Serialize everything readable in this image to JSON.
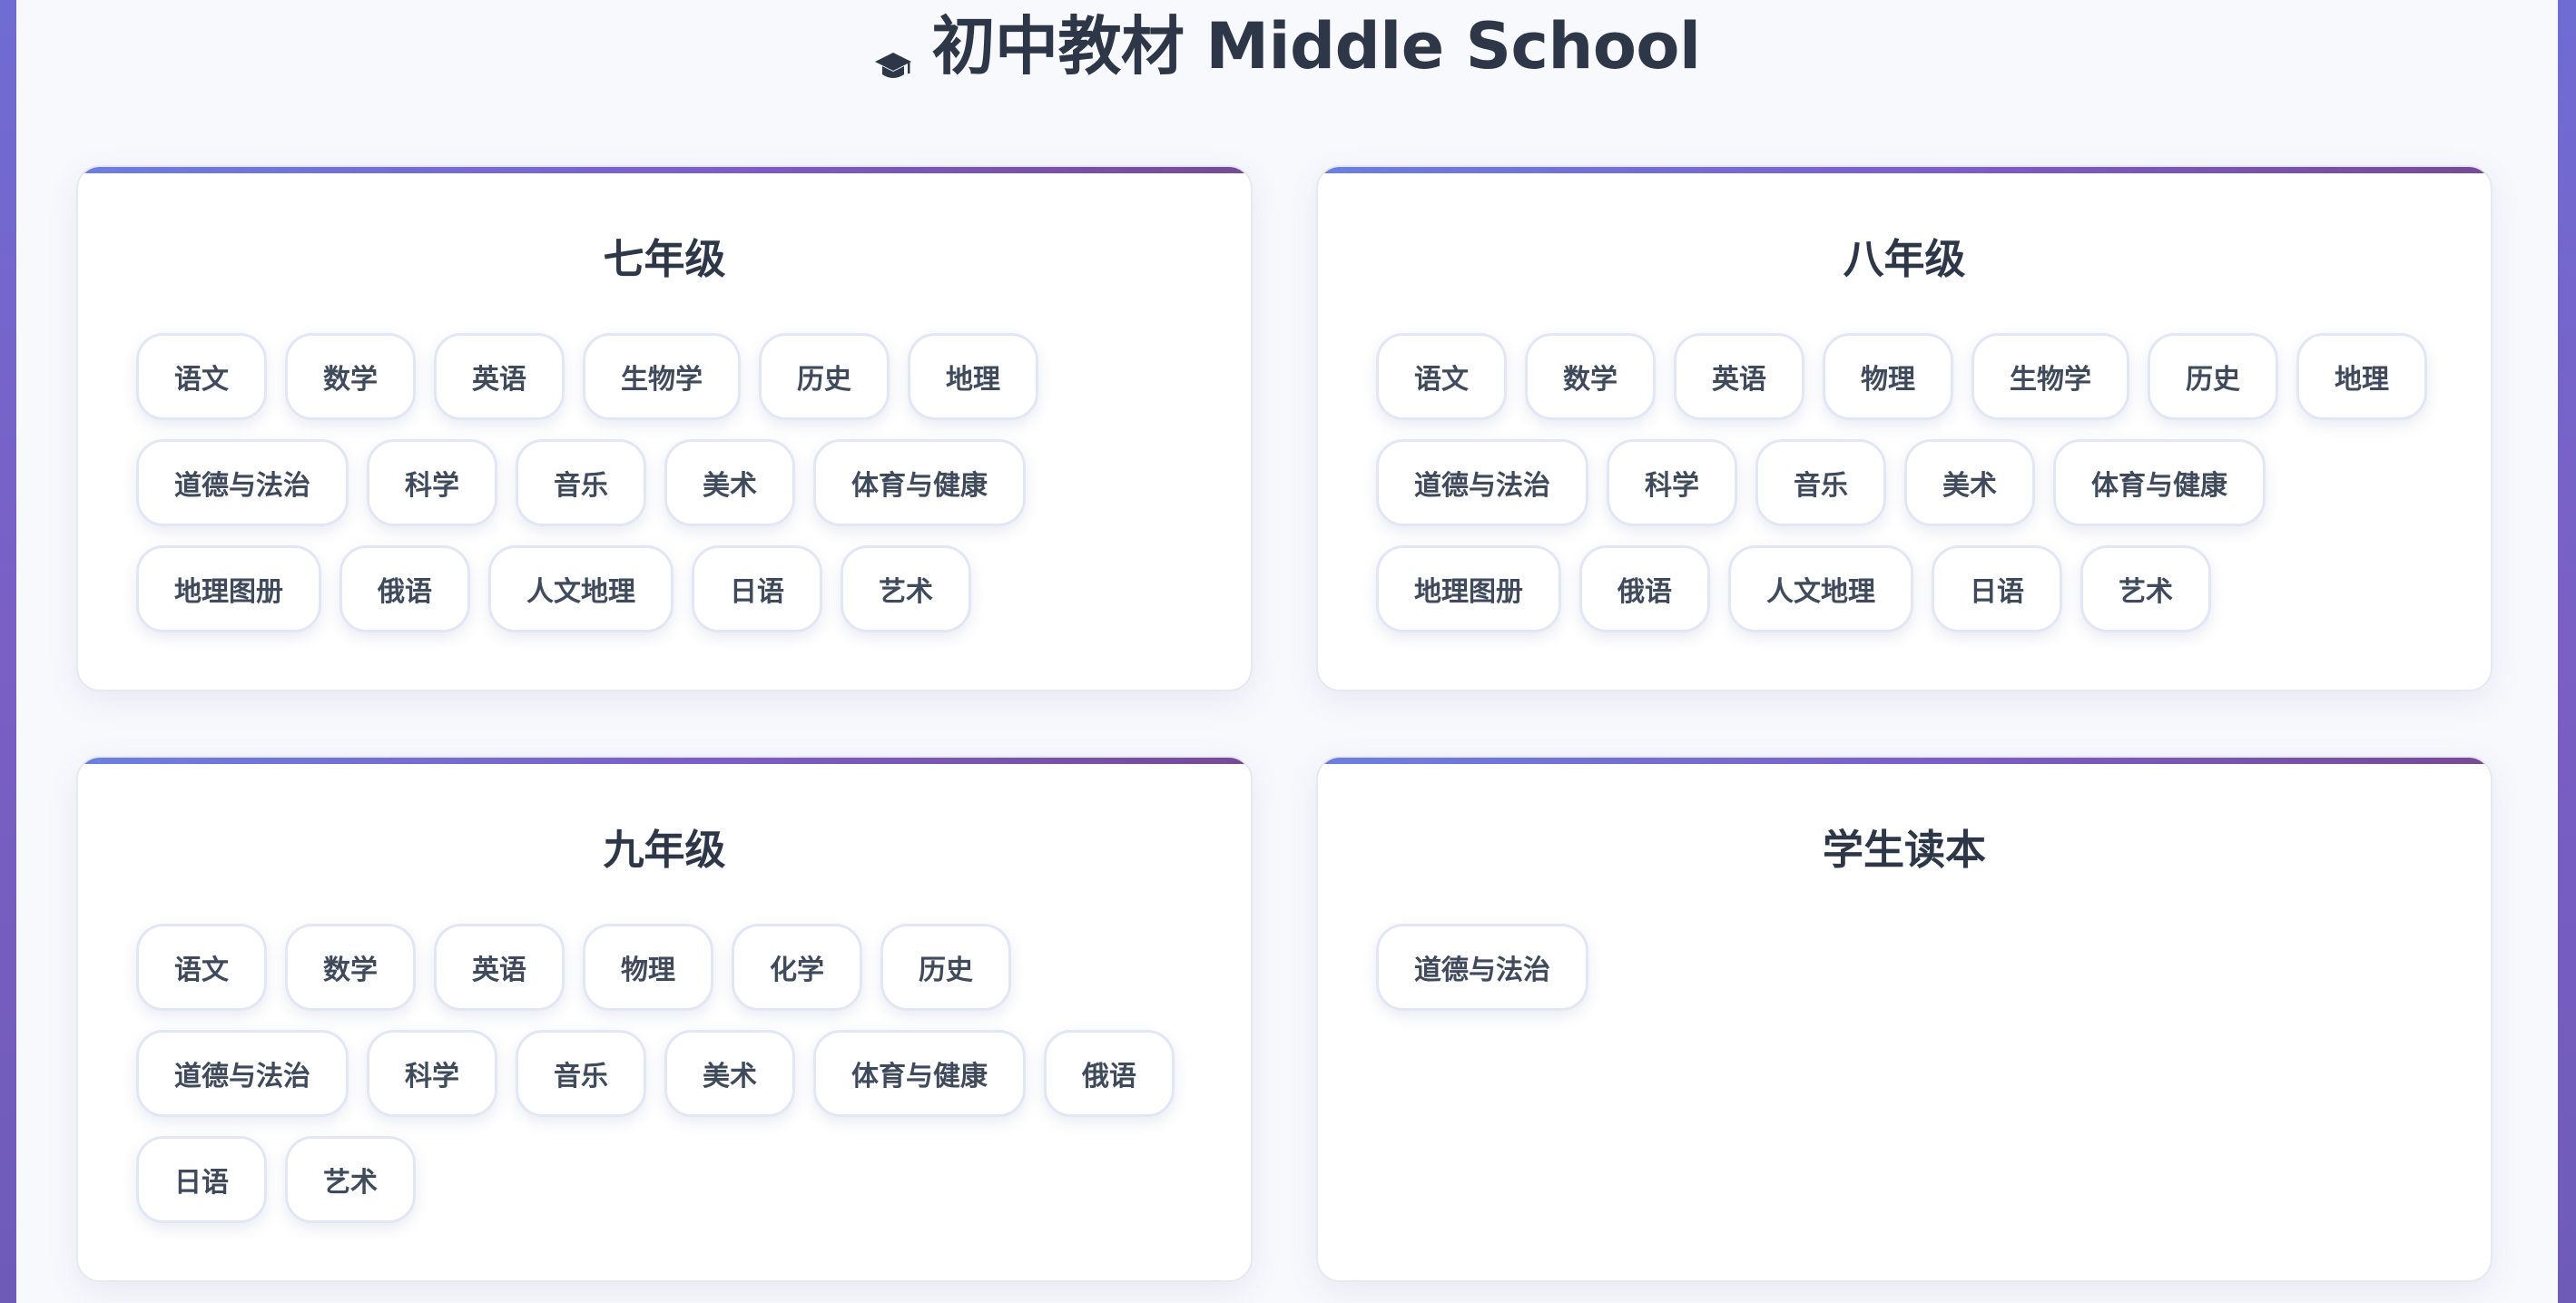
{
  "header": {
    "title": "初中教材 Middle School",
    "icon": "graduation-cap-icon"
  },
  "colors": {
    "accent_start": "#6b7fe0",
    "accent_end": "#774a96",
    "text": "#2d3748"
  },
  "grades": [
    {
      "name": "七年级",
      "subjects": [
        "语文",
        "数学",
        "英语",
        "生物学",
        "历史",
        "地理",
        "道德与法治",
        "科学",
        "音乐",
        "美术",
        "体育与健康",
        "地理图册",
        "俄语",
        "人文地理",
        "日语",
        "艺术"
      ]
    },
    {
      "name": "八年级",
      "subjects": [
        "语文",
        "数学",
        "英语",
        "物理",
        "生物学",
        "历史",
        "地理",
        "道德与法治",
        "科学",
        "音乐",
        "美术",
        "体育与健康",
        "地理图册",
        "俄语",
        "人文地理",
        "日语",
        "艺术"
      ]
    },
    {
      "name": "九年级",
      "subjects": [
        "语文",
        "数学",
        "英语",
        "物理",
        "化学",
        "历史",
        "道德与法治",
        "科学",
        "音乐",
        "美术",
        "体育与健康",
        "俄语",
        "日语",
        "艺术"
      ]
    },
    {
      "name": "学生读本",
      "subjects": [
        "道德与法治"
      ]
    }
  ]
}
